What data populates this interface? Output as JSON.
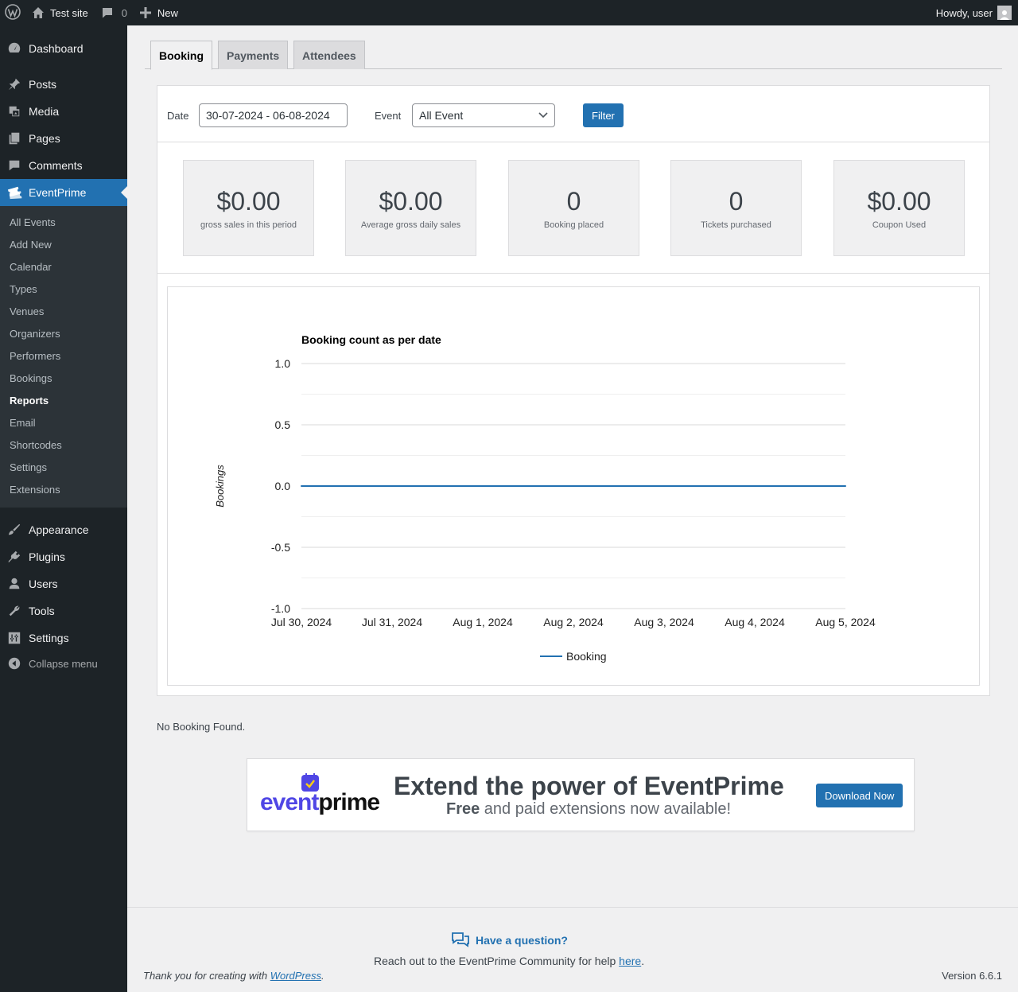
{
  "adminbar": {
    "site_name": "Test site",
    "comments_count": "0",
    "new_label": "New",
    "howdy": "Howdy, user"
  },
  "sidebar": {
    "items": [
      {
        "label": "Dashboard",
        "icon": "dashboard-icon"
      },
      {
        "label": "Posts",
        "icon": "pin-icon"
      },
      {
        "label": "Media",
        "icon": "media-icon"
      },
      {
        "label": "Pages",
        "icon": "pages-icon"
      },
      {
        "label": "Comments",
        "icon": "comment-icon"
      },
      {
        "label": "EventPrime",
        "icon": "tickets-icon"
      },
      {
        "label": "Appearance",
        "icon": "brush-icon"
      },
      {
        "label": "Plugins",
        "icon": "plug-icon"
      },
      {
        "label": "Users",
        "icon": "user-icon"
      },
      {
        "label": "Tools",
        "icon": "wrench-icon"
      },
      {
        "label": "Settings",
        "icon": "sliders-icon"
      }
    ],
    "submenu": [
      "All Events",
      "Add New",
      "Calendar",
      "Types",
      "Venues",
      "Organizers",
      "Performers",
      "Bookings",
      "Reports",
      "Email",
      "Shortcodes",
      "Settings",
      "Extensions"
    ],
    "collapse_label": "Collapse menu"
  },
  "tabs": [
    "Booking",
    "Payments",
    "Attendees"
  ],
  "filter": {
    "date_label": "Date",
    "date_value": "30-07-2024 - 06-08-2024",
    "event_label": "Event",
    "event_value": "All Event",
    "button": "Filter"
  },
  "stats": [
    {
      "value": "$0.00",
      "caption": "gross sales in this period"
    },
    {
      "value": "$0.00",
      "caption": "Average gross daily sales"
    },
    {
      "value": "0",
      "caption": "Booking placed"
    },
    {
      "value": "0",
      "caption": "Tickets purchased"
    },
    {
      "value": "$0.00",
      "caption": "Coupon Used"
    }
  ],
  "chart_data": {
    "type": "line",
    "title": "Booking count as per date",
    "ylabel": "Bookings",
    "xlabel": "",
    "categories": [
      "Jul 30, 2024",
      "Jul 31, 2024",
      "Aug 1, 2024",
      "Aug 2, 2024",
      "Aug 3, 2024",
      "Aug 4, 2024",
      "Aug 5, 2024"
    ],
    "series": [
      {
        "name": "Booking",
        "values": [
          0,
          0,
          0,
          0,
          0,
          0,
          0
        ],
        "color": "#2271b1"
      }
    ],
    "ylim": [
      -1.0,
      1.0
    ],
    "yticks": [
      "1.0",
      "0.5",
      "0.0",
      "-0.5",
      "-1.0"
    ],
    "grid": true,
    "legend": "bottom"
  },
  "no_booking": "No Booking Found.",
  "banner": {
    "logo_text_a": "event",
    "logo_text_b": "prime",
    "title": "Extend the power of EventPrime",
    "sub_bold": "Free",
    "sub_rest": " and paid extensions now available!",
    "button": "Download Now"
  },
  "footer": {
    "question": "Have a question?",
    "reach_text": "Reach out to the EventPrime Community for help ",
    "reach_link": "here",
    "reach_end": ".",
    "thanks_text": "Thank you for creating with ",
    "thanks_link": "WordPress",
    "thanks_end": ".",
    "version": "Version 6.6.1"
  },
  "colors": {
    "accent": "#2271b1",
    "sidebar_bg": "#1d2327",
    "submenu_bg": "#2c3338",
    "logo_purple": "#4f46e5"
  }
}
